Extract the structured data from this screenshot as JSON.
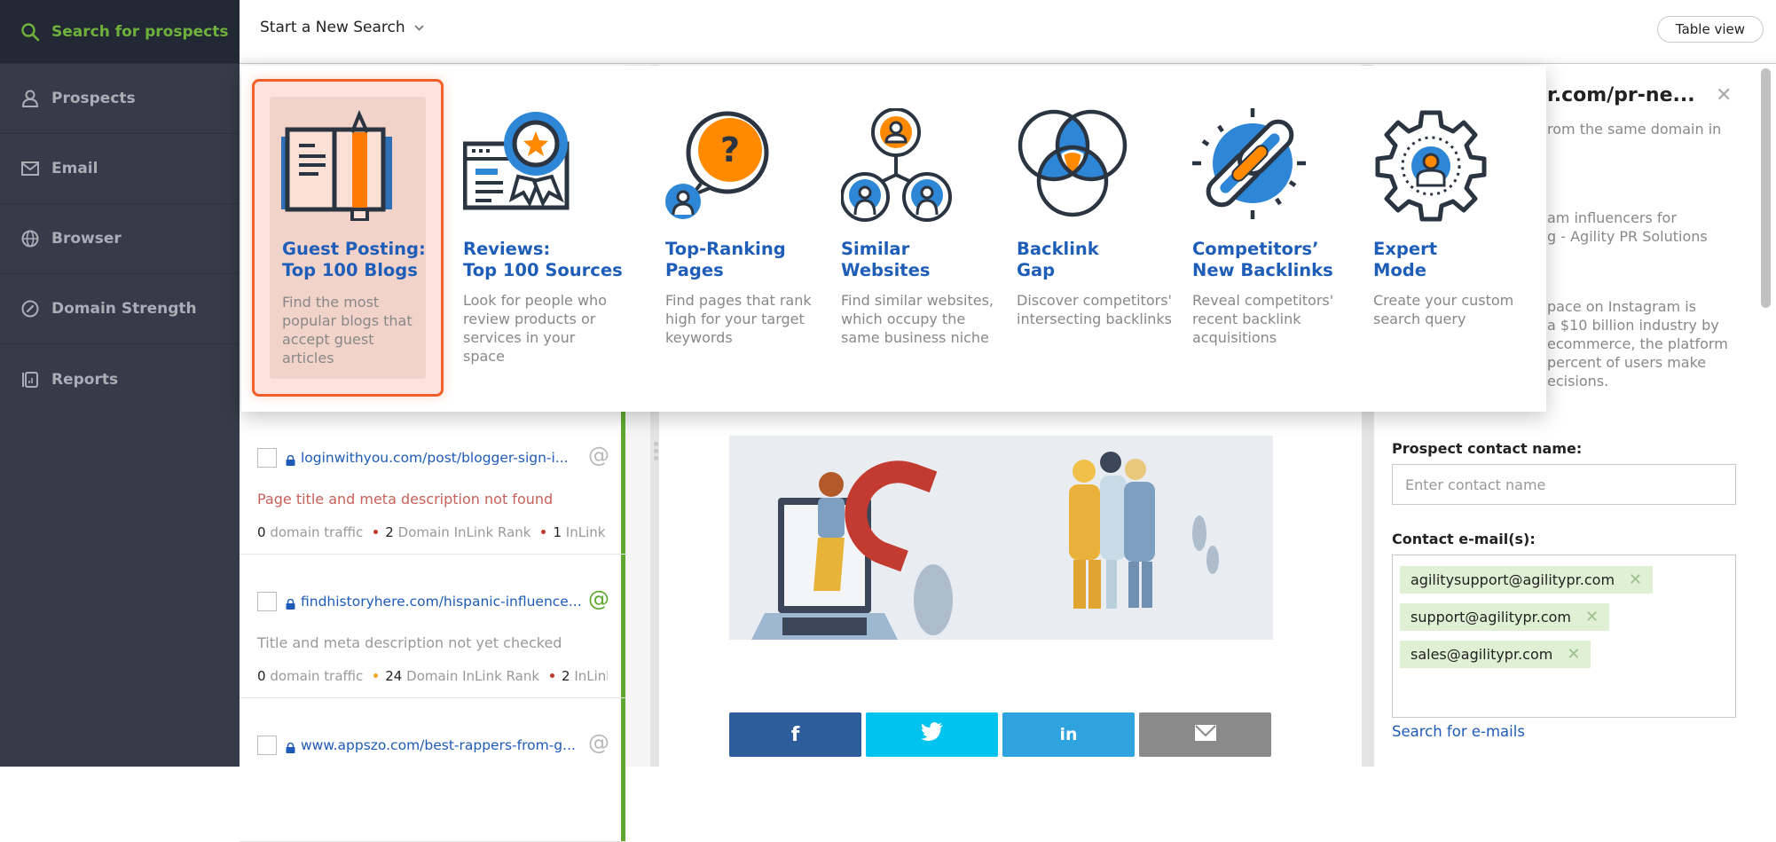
{
  "sidebar": {
    "active": {
      "label": "Search for prospects",
      "icon": "search-icon"
    },
    "items": [
      {
        "label": "Prospects",
        "icon": "user-icon"
      },
      {
        "label": "Email",
        "icon": "envelope-icon"
      },
      {
        "label": "Browser",
        "icon": "globe-icon"
      },
      {
        "label": "Domain Strength",
        "icon": "gauge-icon"
      },
      {
        "label": "Reports",
        "icon": "report-icon"
      }
    ]
  },
  "header": {
    "new_search_label": "Start a New Search",
    "table_view_label": "Table view"
  },
  "search_types": [
    {
      "title_line1": "Guest Posting:",
      "title_line2": "Top 100 Blogs",
      "desc": "Find the most popular blogs that accept guest articles",
      "icon": "book-pencil-icon",
      "selected": true
    },
    {
      "title_line1": "Reviews:",
      "title_line2": "Top 100 Sources",
      "desc": "Look for people who review products or services in your space",
      "icon": "award-ribbon-icon",
      "selected": false
    },
    {
      "title_line1": "Top-Ranking",
      "title_line2": "Pages",
      "desc": "Find pages that rank high for your target keywords",
      "icon": "question-bubble-icon",
      "selected": false
    },
    {
      "title_line1": "Similar",
      "title_line2": "Websites",
      "desc": "Find similar websites, which occupy the same business niche",
      "icon": "user-network-icon",
      "selected": false
    },
    {
      "title_line1": "Backlink",
      "title_line2": "Gap",
      "desc": "Discover competitors' intersecting backlinks",
      "icon": "venn-diagram-icon",
      "selected": false
    },
    {
      "title_line1": "Competitors’",
      "title_line2": "New Backlinks",
      "desc": "Reveal competitors' recent backlink acquisitions",
      "icon": "chain-link-icon",
      "selected": false
    },
    {
      "title_line1": "Expert",
      "title_line2": "Mode",
      "desc": "Create your custom search query",
      "icon": "gear-user-icon",
      "selected": false
    }
  ],
  "prospects": [
    {
      "url": "loginwithyou.com/post/blogger-sign-i...",
      "status": "Page title and meta description not found",
      "status_type": "error",
      "traffic": "0",
      "traffic_label": "domain traffic",
      "dir": "2",
      "dir_label": "Domain InLink Rank",
      "dir_color": "#c0392b",
      "ilr": "1",
      "ilr_label": "InLink Rank",
      "ilr_color": "#c0392b",
      "email_found": false
    },
    {
      "url": "findhistoryhere.com/hispanic-influence...",
      "status": "Title and meta description not yet checked",
      "status_type": "pending",
      "traffic": "0",
      "traffic_label": "domain traffic",
      "dir": "24",
      "dir_label": "Domain InLink Rank",
      "dir_color": "#f5a623",
      "ilr": "2",
      "ilr_label": "InLink Rank",
      "ilr_color": "#c0392b",
      "email_found": true
    },
    {
      "url": "www.appszo.com/best-rappers-from-g...",
      "status": "",
      "status_type": "pending",
      "email_found": false
    }
  ],
  "share_buttons": [
    {
      "name": "facebook",
      "glyph": "f",
      "color": "#2d5d9b"
    },
    {
      "name": "twitter",
      "glyph": "🐦",
      "color": "#00c3f0"
    },
    {
      "name": "linkedin",
      "glyph": "in",
      "color": "#2ea3de"
    },
    {
      "name": "email",
      "glyph": "✉",
      "color": "#8a8a8a"
    }
  ],
  "detail": {
    "title": "agilitypr.com/pr-ne...",
    "title_visible": "r.com/pr-ne...",
    "line1": "rom the same domain in",
    "para2": [
      "am influencers for",
      "g - Agility PR Solutions"
    ],
    "para3": [
      "pace on Instagram is",
      "a $10 billion industry by",
      "ecommerce, the platform",
      "percent of users make",
      "ecisions."
    ],
    "contact_name_label": "Prospect contact name:",
    "contact_name_placeholder": "Enter contact name",
    "contact_name_value": "",
    "emails_label": "Contact e-mail(s):",
    "emails": [
      "agilitysupport@agilitypr.com",
      "support@agilitypr.com",
      "sales@agilitypr.com"
    ],
    "search_emails_label": "Search for e-mails"
  },
  "colors": {
    "accent_green": "#6fb23b",
    "link_blue": "#1f5eb8",
    "selection_orange": "#f4602a",
    "icon_blue": "#2e86d6",
    "icon_orange": "#ff8a00"
  }
}
